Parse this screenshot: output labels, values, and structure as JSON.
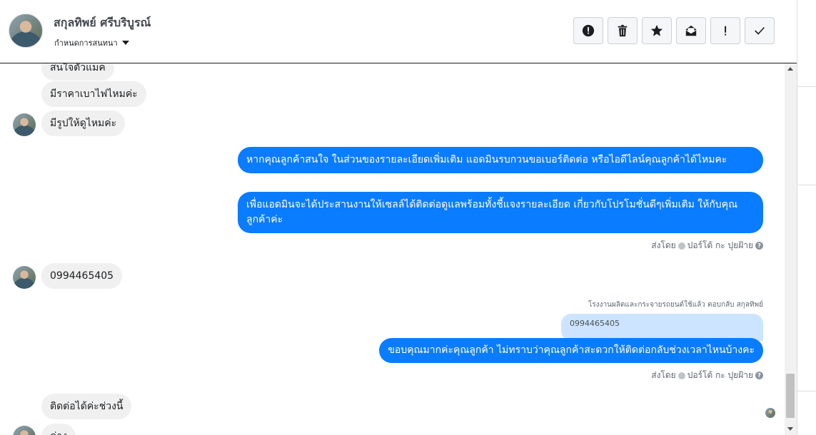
{
  "header": {
    "contact_name": "สกุลทิพย์ ศรีบริบูรณ์",
    "conversation_settings": "กำหนดการสนทนา"
  },
  "actions": [
    {
      "icon": "alert-circle-icon",
      "name": "spam-button"
    },
    {
      "icon": "trash-icon",
      "name": "delete-button"
    },
    {
      "icon": "star-icon",
      "name": "star-button"
    },
    {
      "icon": "mail-open-icon",
      "name": "mark-unread-button"
    },
    {
      "icon": "exclamation-icon",
      "name": "important-button"
    },
    {
      "icon": "check-icon",
      "name": "done-button"
    }
  ],
  "messages": {
    "m0": "สนใจตัวแมค",
    "m1": "มีราคาเบาไฟไหมค่ะ",
    "m2": "มีรูปให้ดูไหมค่ะ",
    "out1": "หากคุณลูกค้าสนใจ ในส่วนของรายละเอียดเพิ่มเติม แอดมินรบกวนขอเบอร์ติดต่อ หรือไอดีไลน์คุณลูกค้าได้ไหมคะ",
    "out2": "เพื่อแอดมินจะได้ประสานงานให้เซลล์ได้ติดต่อดูแลพร้อมทั้งชี้แจงรายละเอียด เกี่ยวกับโปรโมชั่นดีๆเพิ่มเติม ให้กับคุณลูกค้าค่ะ",
    "sent_by_1_prefix": "ส่งโดย",
    "sent_by_1_name": "ปอร์โต้ กะ ปุยฝ้าย",
    "in_phone": "0994465405",
    "reply_note": "โรงงานผลิตและกระจายรถยนต์ใช้แล้ว ตอบกลับ สกุลทิพย์",
    "quoted": "0994465405",
    "out3": "ขอบคุณมากค่ะคุณลูกค้า ไม่ทราบว่าคุณลูกค้าสะดวกให้ติดต่อกลับช่วงเวลาไหนบ้างคะ",
    "sent_by_2_prefix": "ส่งโดย",
    "sent_by_2_name": "ปอร์โต้ กะ ปุยฝ้าย",
    "m_last1": "ติดต่อได้ค่ะช่วงนี้",
    "m_last2": "ค่าง"
  },
  "colors": {
    "outgoing_bubble": "#0a7cff",
    "incoming_bubble": "#f0f0f0",
    "quoted_bubble": "#cce4ff"
  }
}
